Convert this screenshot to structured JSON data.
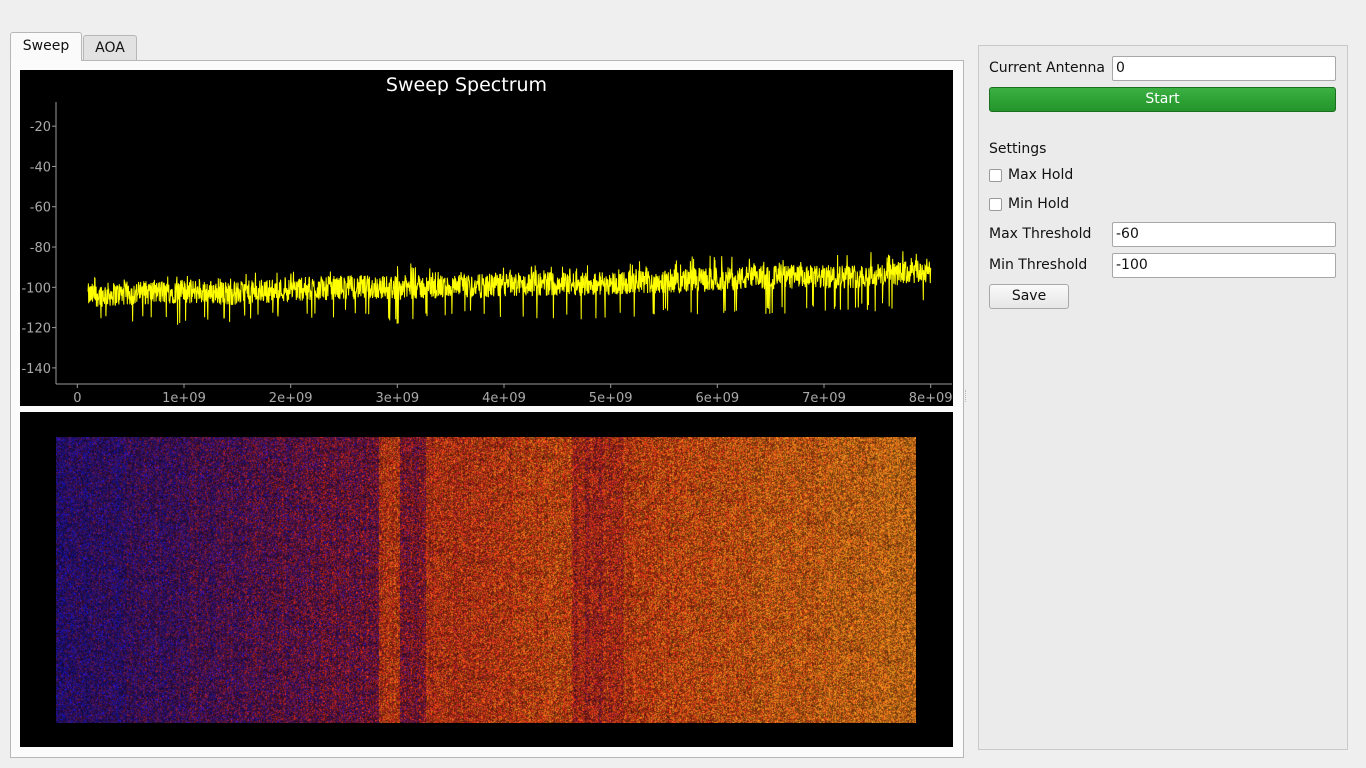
{
  "tabs": [
    {
      "label": "Sweep",
      "active": true
    },
    {
      "label": "AOA",
      "active": false
    }
  ],
  "spectrum": {
    "title": "Sweep Spectrum",
    "line_color": "#ffff00"
  },
  "chart_data": {
    "type": "line",
    "title": "Sweep Spectrum",
    "xlabel": "",
    "ylabel": "",
    "x_ticks": [
      "0",
      "1e+09",
      "2e+09",
      "3e+09",
      "4e+09",
      "5e+09",
      "6e+09",
      "7e+09",
      "8e+09"
    ],
    "y_ticks": [
      "-20",
      "-40",
      "-60",
      "-80",
      "-100",
      "-120",
      "-140"
    ],
    "xlim": [
      -200000000.0,
      8200000000.0
    ],
    "ylim": [
      -148,
      -8
    ],
    "grid": false,
    "series": [
      {
        "color": "#ffff00",
        "x": [
          100000000.0,
          500000000.0,
          1000000000.0,
          1500000000.0,
          2000000000.0,
          2500000000.0,
          3000000000.0,
          3500000000.0,
          4000000000.0,
          4500000000.0,
          5000000000.0,
          5500000000.0,
          6000000000.0,
          6500000000.0,
          7000000000.0,
          7500000000.0,
          8000000000.0
        ],
        "y_mean": [
          -104,
          -103,
          -102,
          -103,
          -101,
          -100,
          -100,
          -100,
          -99,
          -98,
          -98,
          -97,
          -96,
          -95,
          -95,
          -94,
          -92
        ],
        "y_min": [
          -116,
          -118,
          -119,
          -117,
          -116,
          -115,
          -119,
          -114,
          -116,
          -116,
          -117,
          -114,
          -113,
          -114,
          -112,
          -112,
          -109
        ],
        "y_max": [
          -94,
          -96,
          -94,
          -93,
          -92,
          -91,
          -87,
          -90,
          -89,
          -89,
          -88,
          -86,
          -83,
          -86,
          -84,
          -82,
          -82
        ]
      }
    ]
  },
  "waterfall": {
    "colormap": [
      "#1a1aa8",
      "#3a1470",
      "#7a1a2a",
      "#c83214",
      "#ff4a1a",
      "#ff8a20"
    ]
  },
  "panel": {
    "current_antenna_label": "Current Antenna",
    "current_antenna_value": "0",
    "start_label": "Start",
    "settings_label": "Settings",
    "max_hold_label": "Max Hold",
    "max_hold_checked": false,
    "min_hold_label": "Min Hold",
    "min_hold_checked": false,
    "max_threshold_label": "Max Threshold",
    "max_threshold_value": "-60",
    "min_threshold_label": "Min Threshold",
    "min_threshold_value": "-100",
    "save_label": "Save",
    "start_color": "#2aa232"
  }
}
